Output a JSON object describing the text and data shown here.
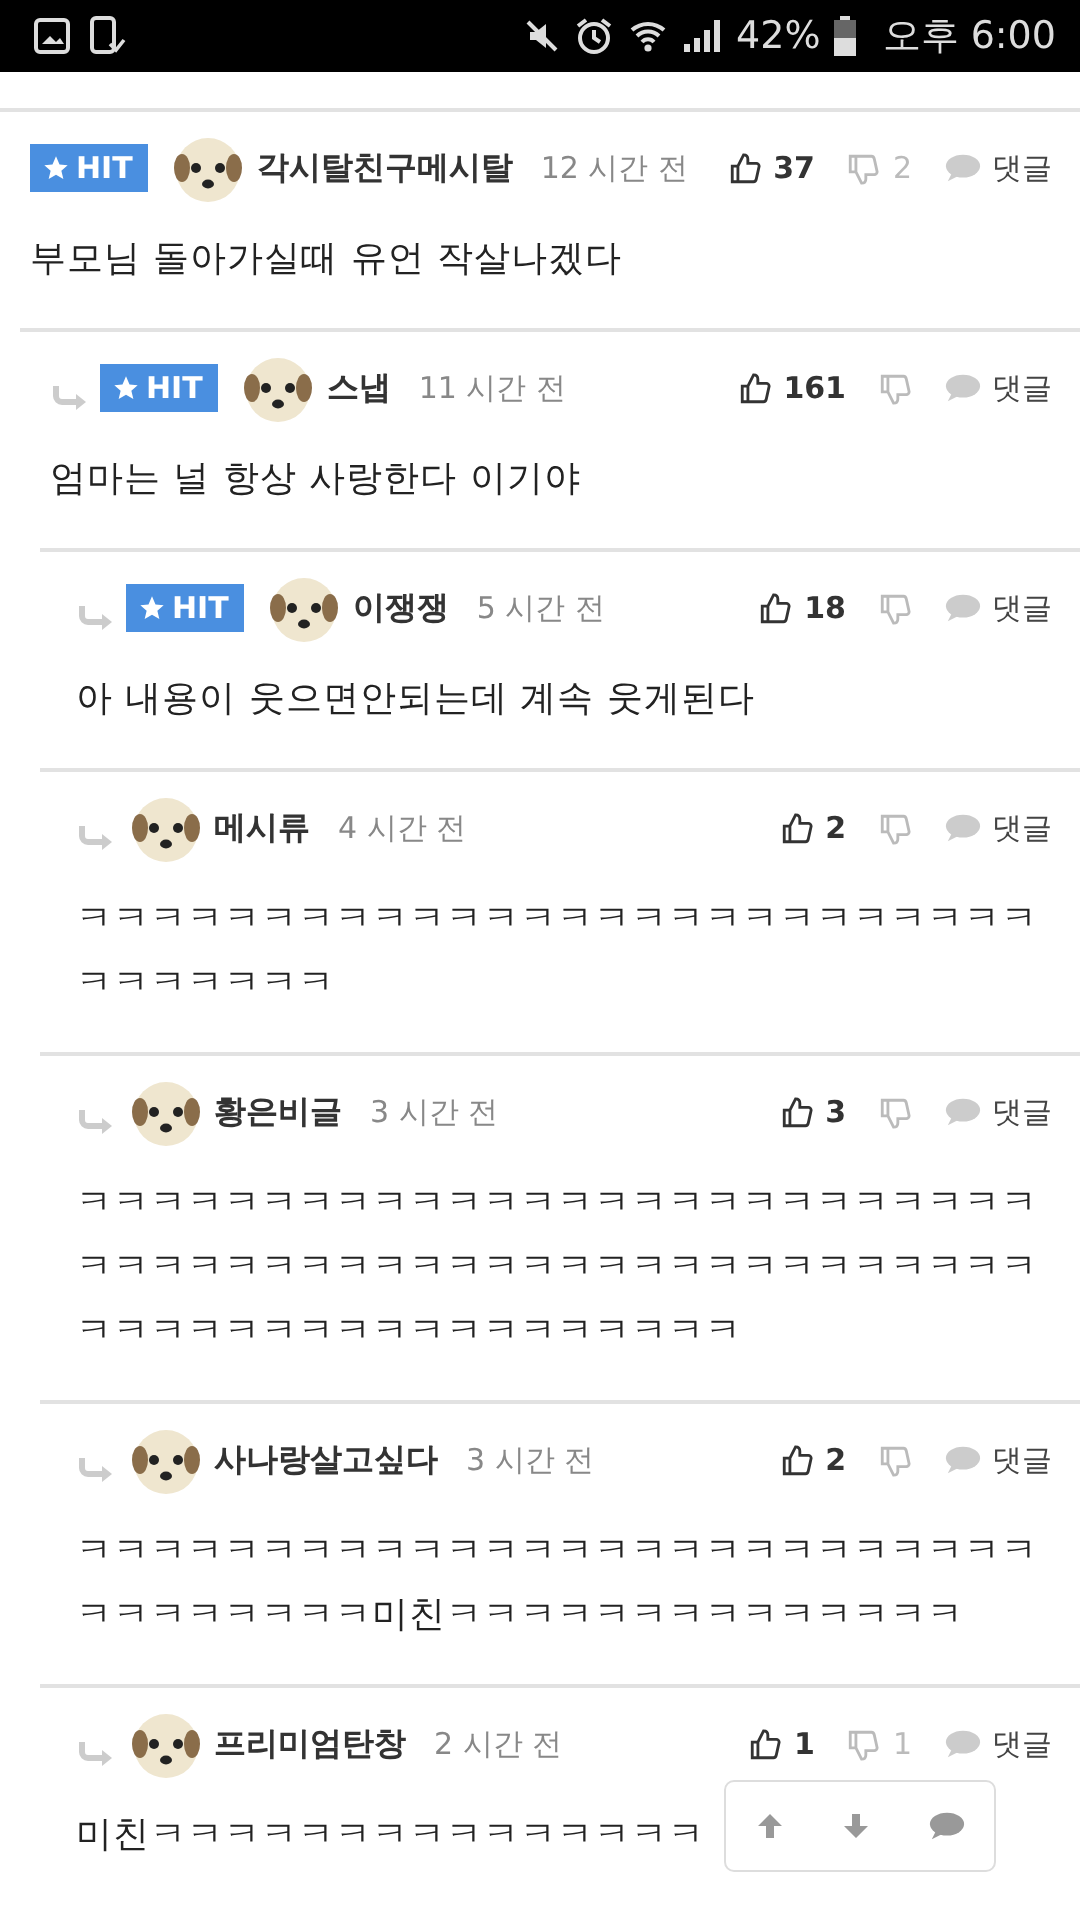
{
  "status_bar": {
    "battery": "42%",
    "time": "오후 6:00"
  },
  "comments": [
    {
      "badge": "HIT",
      "author": "각시탈친구메시탈",
      "time": "12 시간 전",
      "likes": "37",
      "dislikes": "2",
      "reply_label": "댓글",
      "body": "부모님 돌아가실때 유언 작살나겠다",
      "children": [
        {
          "badge": "HIT",
          "author": "스냅",
          "time": "11 시간 전",
          "likes": "161",
          "reply_label": "댓글",
          "body": "엄마는 널 항상 사랑한다 이기야",
          "children": [
            {
              "badge": "HIT",
              "author": "이쟁쟁",
              "time": "5 시간 전",
              "likes": "18",
              "reply_label": "댓글",
              "body": "아 내용이 웃으면안되는데 계속 웃게된다"
            },
            {
              "author": "메시류",
              "time": "4 시간 전",
              "likes": "2",
              "reply_label": "댓글",
              "body": "ㅋㅋㅋㅋㅋㅋㅋㅋㅋㅋㅋㅋㅋㅋㅋㅋㅋㅋㅋㅋㅋㅋㅋㅋㅋㅋㅋㅋㅋㅋㅋㅋㅋ"
            },
            {
              "author": "황은비글",
              "time": "3 시간 전",
              "likes": "3",
              "reply_label": "댓글",
              "body": "ㅋㅋㅋㅋㅋㅋㅋㅋㅋㅋㅋㅋㅋㅋㅋㅋㅋㅋㅋㅋㅋㅋㅋㅋㅋㅋㅋㅋㅋㅋㅋㅋㅋㅋㅋㅋㅋㅋㅋㅋㅋㅋㅋㅋㅋㅋㅋㅋㅋㅋㅋㅋㅋㅋㅋㅋㅋㅋㅋㅋㅋㅋㅋㅋㅋㅋㅋㅋㅋㅋ"
            },
            {
              "author": "사나랑살고싶다",
              "time": "3 시간 전",
              "likes": "2",
              "reply_label": "댓글",
              "body": "ㅋㅋㅋㅋㅋㅋㅋㅋㅋㅋㅋㅋㅋㅋㅋㅋㅋㅋㅋㅋㅋㅋㅋㅋㅋㅋㅋㅋㅋㅋㅋㅋㅋㅋ미친ㅋㅋㅋㅋㅋㅋㅋㅋㅋㅋㅋㅋㅋㅋ"
            },
            {
              "author": "프리미엄탄창",
              "time": "2 시간 전",
              "likes": "1",
              "dislikes": "1",
              "reply_label": "댓글",
              "body": "미친ㅋㅋㅋㅋㅋㅋㅋㅋㅋㅋㅋㅋㅋㅋㅋ"
            }
          ]
        }
      ]
    }
  ]
}
